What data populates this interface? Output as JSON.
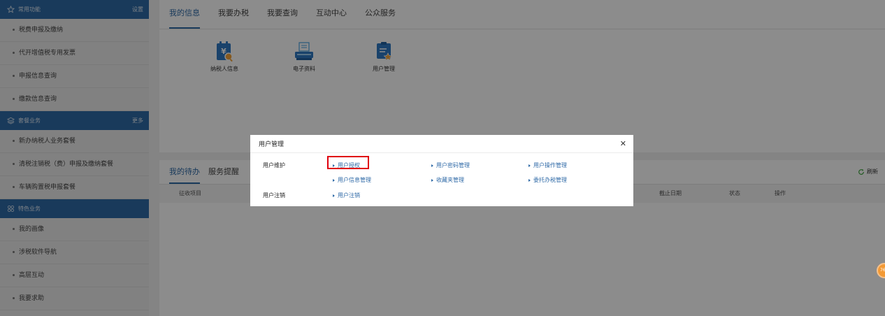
{
  "sidebar": {
    "sections": [
      {
        "title": "常用功能",
        "link": "设置",
        "icon": "star-icon",
        "items": [
          "税费申报及缴纳",
          "代开增值税专用发票",
          "申报信息查询",
          "缴款信息查询"
        ]
      },
      {
        "title": "套餐业务",
        "link": "更多",
        "icon": "layers-icon",
        "items": [
          "新办纳税人业务套餐",
          "清税注销税（费）申报及缴纳套餐",
          "车辆购置税申报套餐"
        ]
      },
      {
        "title": "特色业务",
        "link": "",
        "icon": "grid-icon",
        "items": [
          "我的画像",
          "涉税软件导航",
          "高层互动",
          "我要求助"
        ]
      }
    ]
  },
  "main": {
    "tabs": [
      "我的信息",
      "我要办税",
      "我要查询",
      "互动中心",
      "公众服务"
    ],
    "apps": [
      {
        "label": "纳税人信息",
        "icon": "taxpayer-info-icon"
      },
      {
        "label": "电子资料",
        "icon": "electronic-docs-icon"
      },
      {
        "label": "用户管理",
        "icon": "user-management-icon"
      }
    ]
  },
  "todo": {
    "tabs": [
      "我的待办",
      "服务提醒"
    ],
    "refresh": "刷新",
    "columns": {
      "item": "征收项目",
      "deadline": "截止日期",
      "status": "状态",
      "op": "操作"
    }
  },
  "modal": {
    "title": "用户管理",
    "rows": [
      {
        "label": "用户维护",
        "links": [
          "用户授权",
          "用户密码管理",
          "用户操作管理",
          "用户信息管理",
          "收藏夹管理",
          "委托办税管理"
        ]
      },
      {
        "label": "用户注销",
        "links": [
          "用户注销"
        ]
      }
    ]
  },
  "badge": "76",
  "colors": {
    "brand": "#2f6aa7",
    "highlight": "#e0000e",
    "badge": "#f39a35"
  }
}
